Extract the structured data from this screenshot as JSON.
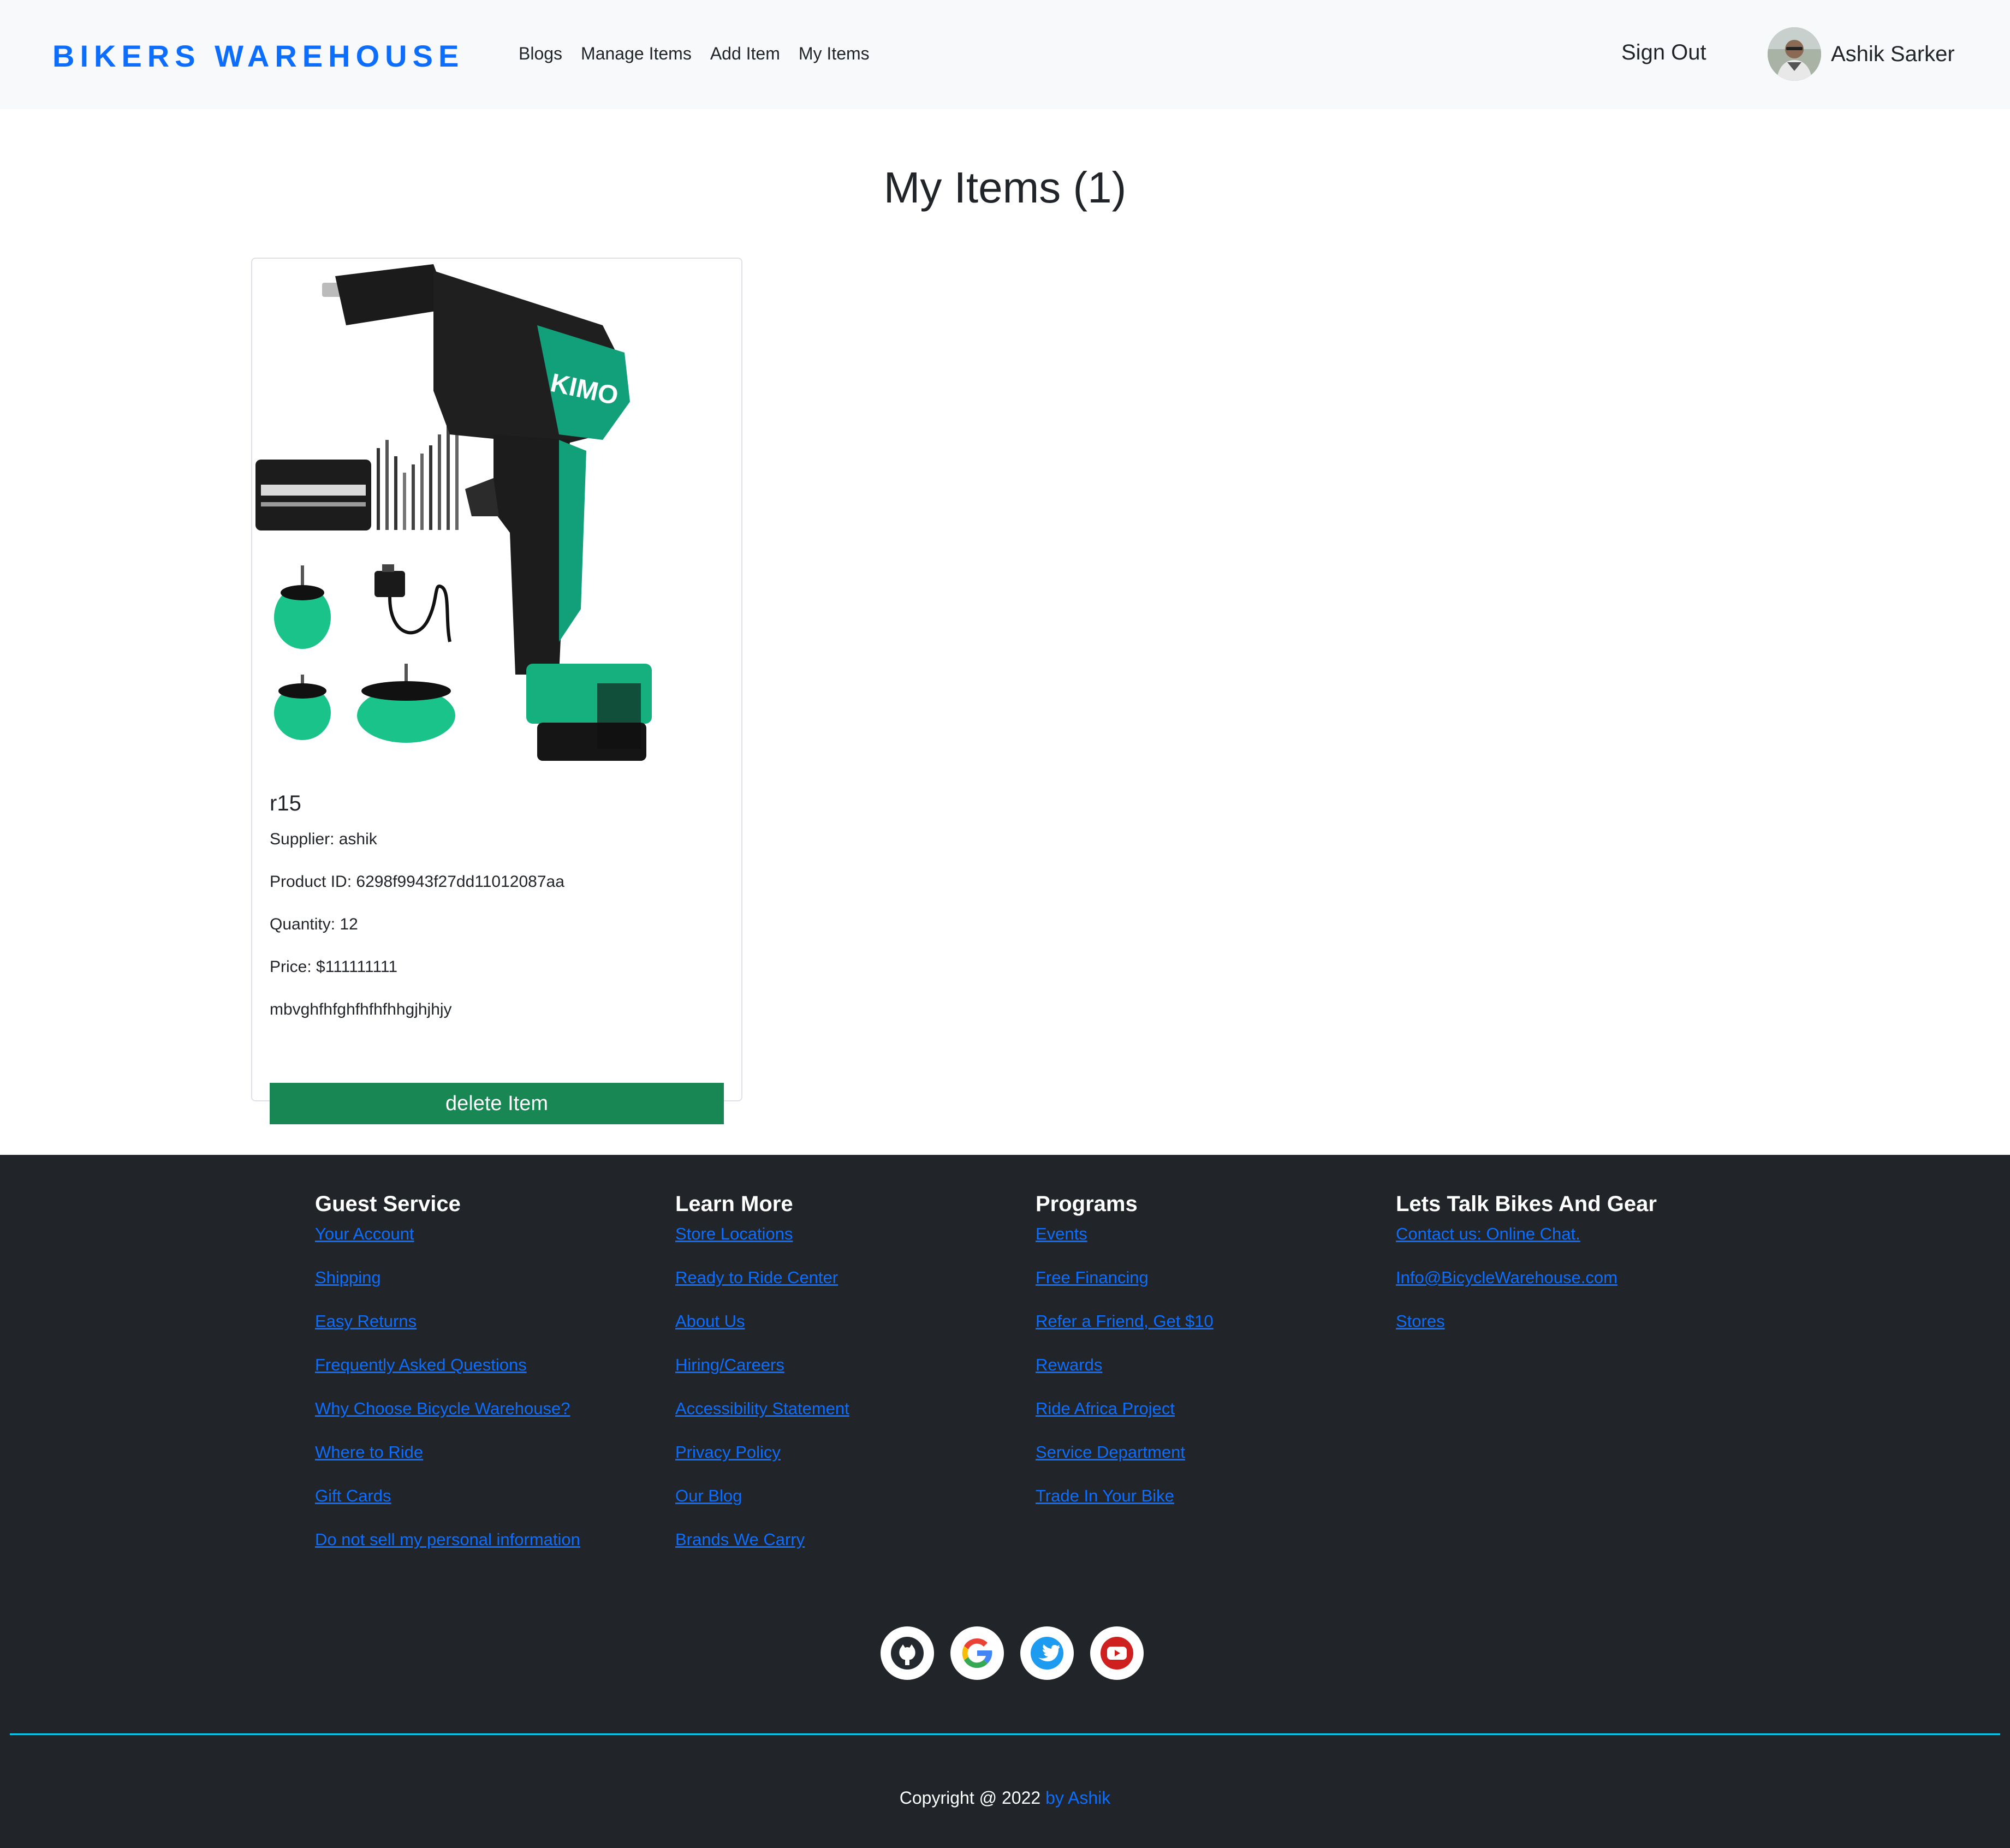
{
  "navbar": {
    "brand": "BIKERS WAREHOUSE",
    "links": [
      "Blogs",
      "Manage Items",
      "Add Item",
      "My Items"
    ],
    "sign_out": "Sign Out",
    "user_name": "Ashik Sarker"
  },
  "main": {
    "title": "My Items (1)",
    "items": [
      {
        "name": "r15",
        "supplier": "Supplier: ashik",
        "product_id": "Product ID: 6298f9943f27dd11012087aa",
        "quantity": "Quantity: 12",
        "price": "Price: $111111111",
        "description": "mbvghfhfghfhfhfhhgjhjhjy",
        "image_brand": "KIMO",
        "delete_label": "delete Item"
      }
    ]
  },
  "footer": {
    "columns": [
      {
        "heading": "Guest Service",
        "links": [
          "Your Account",
          "Shipping",
          "Easy Returns",
          "Frequently Asked Questions",
          "Why Choose Bicycle Warehouse?",
          "Where to Ride",
          "Gift Cards",
          "Do not sell my personal information"
        ]
      },
      {
        "heading": "Learn More",
        "links": [
          "Store Locations",
          "Ready to Ride Center",
          "About Us",
          "Hiring/Careers",
          "Accessibility Statement",
          "Privacy Policy",
          "Our Blog",
          "Brands We Carry"
        ]
      },
      {
        "heading": "Programs",
        "links": [
          "Events",
          "Free Financing",
          "Refer a Friend, Get $10",
          "Rewards",
          "Ride Africa Project",
          "Service Department",
          "Trade In Your Bike"
        ]
      },
      {
        "heading": "Lets Talk Bikes And Gear",
        "links": [
          "Contact us: Online Chat.",
          "Info@BicycleWarehouse.com",
          "Stores"
        ]
      }
    ],
    "socials": [
      "github-icon",
      "google-icon",
      "twitter-icon",
      "youtube-icon"
    ],
    "copyright_text": "Copyright @ 2022 ",
    "copyright_author": "by Ashik"
  },
  "colors": {
    "brand": "#0d6efd",
    "delete_button": "#198754",
    "footer_bg": "#212529",
    "divider": "#0dcaf0"
  }
}
